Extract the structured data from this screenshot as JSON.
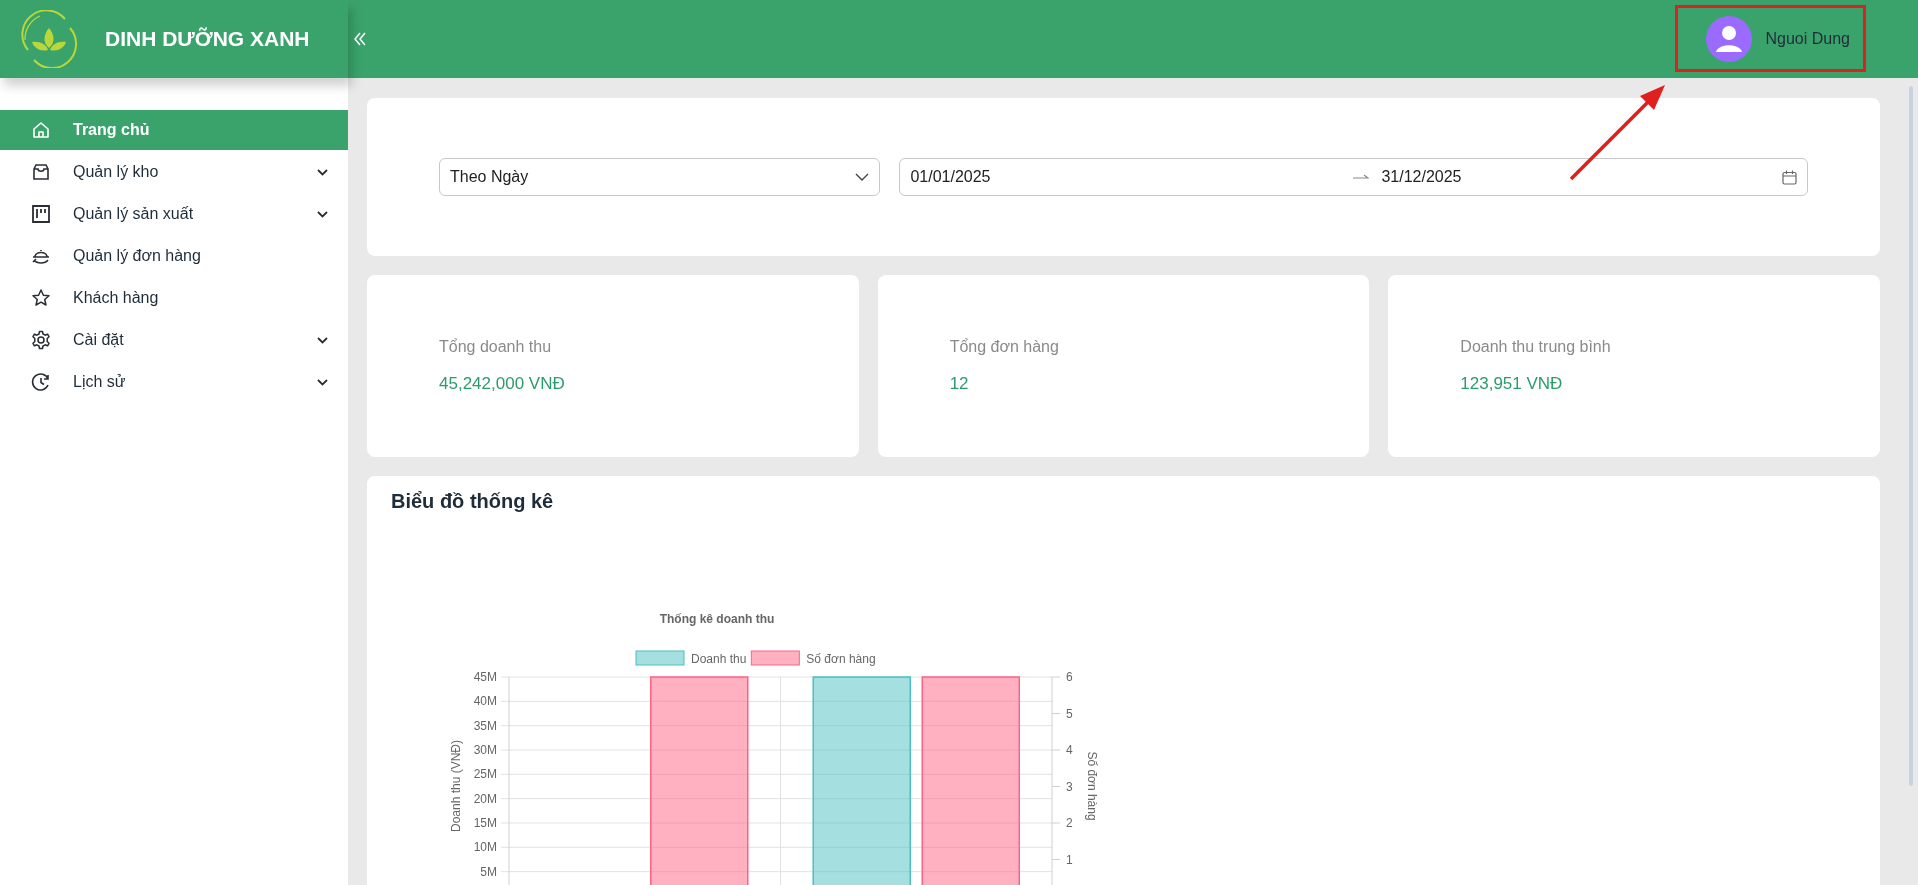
{
  "header": {
    "brand": "DINH DƯỠNG XANH",
    "user_name": "Nguoi Dung"
  },
  "sidebar": {
    "items": [
      {
        "label": "Trang chủ",
        "selected": true,
        "expandable": false
      },
      {
        "label": "Quản lý kho",
        "selected": false,
        "expandable": true
      },
      {
        "label": "Quản lý sản xuất",
        "selected": false,
        "expandable": true
      },
      {
        "label": "Quản lý đơn hàng",
        "selected": false,
        "expandable": false
      },
      {
        "label": "Khách hàng",
        "selected": false,
        "expandable": false
      },
      {
        "label": "Cài đặt",
        "selected": false,
        "expandable": true
      },
      {
        "label": "Lịch sử",
        "selected": false,
        "expandable": true
      }
    ]
  },
  "filter": {
    "period": "Theo Ngày",
    "date_start": "01/01/2025",
    "date_end": "31/12/2025"
  },
  "stats": [
    {
      "label": "Tổng doanh thu",
      "value": "45,242,000 VNĐ"
    },
    {
      "label": "Tổng đơn hàng",
      "value": "12"
    },
    {
      "label": "Doanh thu trung bình",
      "value": "123,951 VNĐ"
    }
  ],
  "chart_card": {
    "title": "Biểu đồ thống kê",
    "chart_data": {
      "type": "bar",
      "grid": true,
      "legend": "top",
      "title": "Thống kê doanh thu",
      "ylabel": "Doanh thu (VNĐ)",
      "y2label": "Số đơn hàng",
      "ylim": [
        0,
        45000000
      ],
      "y2lim": [
        0,
        6
      ],
      "yticks": [
        {
          "value": 5000000,
          "label": "5M"
        },
        {
          "value": 10000000,
          "label": "10M"
        },
        {
          "value": 15000000,
          "label": "15M"
        },
        {
          "value": 20000000,
          "label": "20M"
        },
        {
          "value": 25000000,
          "label": "25M"
        },
        {
          "value": 30000000,
          "label": "30M"
        },
        {
          "value": 35000000,
          "label": "35M"
        },
        {
          "value": 40000000,
          "label": "40M"
        },
        {
          "value": 45000000,
          "label": "45M"
        }
      ],
      "y2ticks": [
        1,
        2,
        3,
        4,
        5,
        6
      ],
      "series": [
        {
          "name": "Doanh thu",
          "color": "#4bc0c0",
          "values": [
            0,
            45000000
          ]
        },
        {
          "name": "Số đơn hàng",
          "color": "#ff6384",
          "axis": "y2",
          "values": [
            6,
            6
          ]
        }
      ]
    }
  }
}
